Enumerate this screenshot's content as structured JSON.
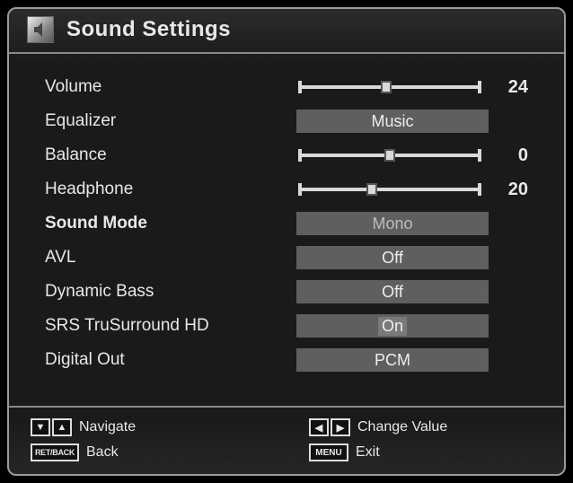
{
  "title": "Sound Settings",
  "settings": {
    "volume": {
      "label": "Volume",
      "type": "slider",
      "value": 24,
      "min": 0,
      "max": 50,
      "pct": 48
    },
    "equalizer": {
      "label": "Equalizer",
      "type": "select",
      "value": "Music"
    },
    "balance": {
      "label": "Balance",
      "type": "slider",
      "value": 0,
      "min": -50,
      "max": 50,
      "pct": 50
    },
    "headphone": {
      "label": "Headphone",
      "type": "slider",
      "value": 20,
      "min": 0,
      "max": 50,
      "pct": 40
    },
    "soundMode": {
      "label": "Sound Mode",
      "type": "select",
      "value": "Mono",
      "bold": true,
      "dim": true
    },
    "avl": {
      "label": "AVL",
      "type": "select",
      "value": "Off"
    },
    "dynamicBass": {
      "label": "Dynamic Bass",
      "type": "select",
      "value": "Off"
    },
    "srs": {
      "label": "SRS TruSurround HD",
      "type": "select",
      "value": "On",
      "highlight": true
    },
    "digitalOut": {
      "label": "Digital Out",
      "type": "select",
      "value": "PCM"
    }
  },
  "hints": {
    "navigate": "Navigate",
    "back": "Back",
    "changeValue": "Change Value",
    "exit": "Exit",
    "keys": {
      "retback": "RET/BACK",
      "menu": "MENU"
    }
  }
}
